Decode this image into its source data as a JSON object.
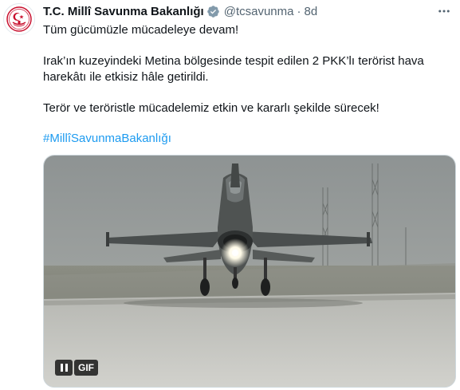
{
  "author": {
    "name": "T.C. Millî Savunma Bakanlığı",
    "handle": "@tcsavunma",
    "separator": "·",
    "time": "8d",
    "avatar_icon": "ministry-emblem-icon",
    "verified_icon": "verified-badge-icon",
    "verified_color": "#829aab"
  },
  "tweet": {
    "paragraph1": "Tüm gücümüzle mücadeleye devam!",
    "paragraph2": "Irak’ın kuzeyindeki Metina bölgesinde tespit edilen 2 PKK’lı terörist hava harekâtı ile etkisiz hâle getirildi.",
    "paragraph3": "Terör ve teröristle mücadelemiz etkin ve kararlı şekilde sürecek!",
    "hashtag": "#MillîSavunmaBakanlığı"
  },
  "media": {
    "type": "gif",
    "gif_label": "GIF",
    "pause_icon": "pause-icon",
    "subject": "fighter-jet-icon"
  },
  "colors": {
    "accent": "#1d9bf0",
    "emblem_red": "#c8102e"
  }
}
